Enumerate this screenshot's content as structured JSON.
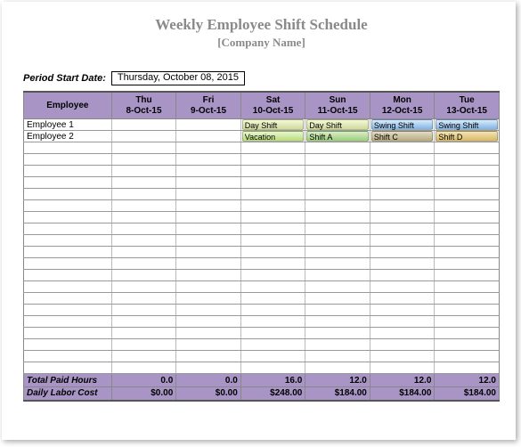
{
  "title": "Weekly Employee Shift Schedule",
  "subtitle": "[Company Name]",
  "period": {
    "label": "Period Start Date:",
    "value": "Thursday, October 08, 2015"
  },
  "header": {
    "employee_label": "Employee",
    "days": [
      {
        "dow": "Thu",
        "date": "8-Oct-15"
      },
      {
        "dow": "Fri",
        "date": "9-Oct-15"
      },
      {
        "dow": "Sat",
        "date": "10-Oct-15"
      },
      {
        "dow": "Sun",
        "date": "11-Oct-15"
      },
      {
        "dow": "Mon",
        "date": "12-Oct-15"
      },
      {
        "dow": "Tue",
        "date": "13-Oct-15"
      }
    ]
  },
  "rows": [
    {
      "name": "Employee 1",
      "cells": [
        "",
        "",
        {
          "text": "Day Shift",
          "cls": "c-day"
        },
        {
          "text": "Day Shift",
          "cls": "c-day"
        },
        {
          "text": "Swing Shift",
          "cls": "c-swing"
        },
        {
          "text": "Swing Shift",
          "cls": "c-swing"
        }
      ]
    },
    {
      "name": "Employee 2",
      "cells": [
        "",
        "",
        {
          "text": "Vacation",
          "cls": "c-vacation"
        },
        {
          "text": "Shift A",
          "cls": "c-shifta"
        },
        {
          "text": "Shift C",
          "cls": "c-shiftc"
        },
        {
          "text": "Shift D",
          "cls": "c-shiftd"
        }
      ]
    }
  ],
  "footer": {
    "totals_label": "Total Paid Hours",
    "totals": [
      "0.0",
      "0.0",
      "16.0",
      "12.0",
      "12.0",
      "12.0"
    ],
    "cost_label": "Daily Labor Cost",
    "costs": [
      "$0.00",
      "$0.00",
      "$248.00",
      "$184.00",
      "$184.00",
      "$184.00"
    ]
  },
  "blank_rows": 20
}
